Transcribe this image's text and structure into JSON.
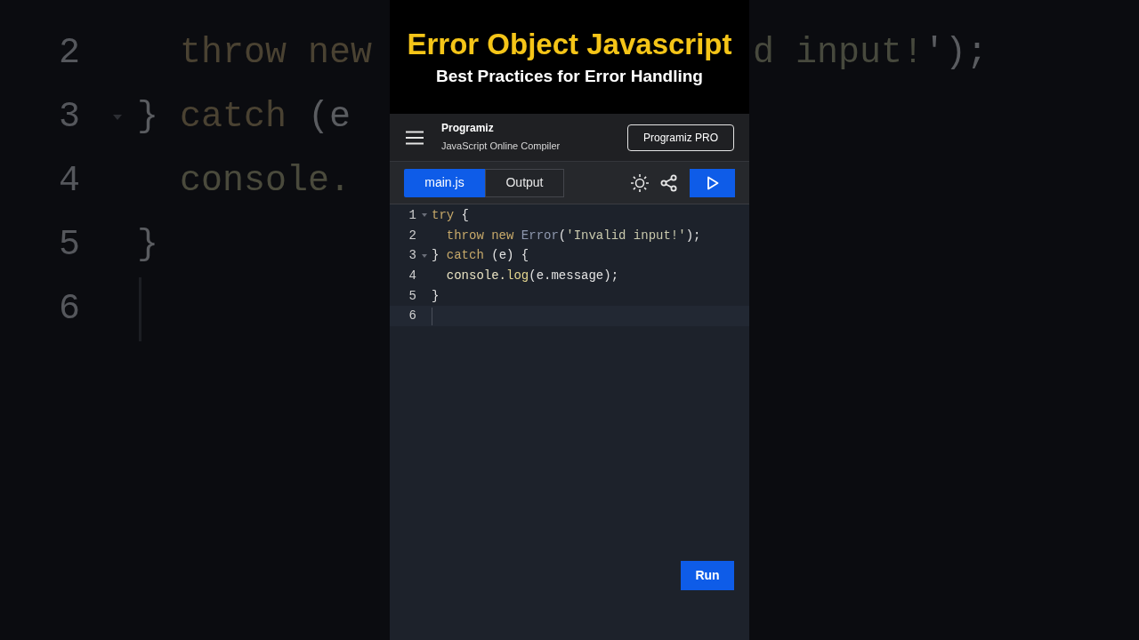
{
  "video_title": {
    "title": "Error Object Javascript",
    "subtitle": "Best Practices for Error Handling"
  },
  "header": {
    "logo": "Programiz",
    "subtitle": "JavaScript Online Compiler",
    "pro_button": "Programiz PRO"
  },
  "tabs": [
    {
      "label": "main.js",
      "selected": true
    },
    {
      "label": "Output",
      "selected": false
    }
  ],
  "editor": {
    "lines": [
      {
        "number": "1",
        "foldable": true,
        "active": false,
        "tokens": [
          {
            "text": "try",
            "kind": "keyword"
          },
          {
            "text": " {",
            "kind": "plain"
          }
        ]
      },
      {
        "number": "2",
        "foldable": false,
        "active": false,
        "tokens": [
          {
            "text": "  throw new ",
            "kind": "keyword"
          },
          {
            "text": "Error",
            "kind": "type"
          },
          {
            "text": "(",
            "kind": "plain"
          },
          {
            "text": "'Invalid input!'",
            "kind": "string"
          },
          {
            "text": ");",
            "kind": "plain"
          }
        ]
      },
      {
        "number": "3",
        "foldable": true,
        "active": false,
        "tokens": [
          {
            "text": "} ",
            "kind": "plain"
          },
          {
            "text": "catch",
            "kind": "keyword"
          },
          {
            "text": " (e) {",
            "kind": "plain"
          }
        ]
      },
      {
        "number": "4",
        "foldable": false,
        "active": false,
        "tokens": [
          {
            "text": "  console.",
            "kind": "object"
          },
          {
            "text": "log",
            "kind": "method"
          },
          {
            "text": "(e.message);",
            "kind": "plain"
          }
        ]
      },
      {
        "number": "5",
        "foldable": false,
        "active": false,
        "tokens": [
          {
            "text": "}",
            "kind": "plain"
          }
        ]
      },
      {
        "number": "6",
        "foldable": false,
        "active": true
      }
    ]
  },
  "run_button": "Run",
  "backdrop": {
    "left_lines": [
      {
        "number": "2",
        "foldable": false,
        "cursor": false,
        "tokens": [
          {
            "text": "  throw new",
            "kind": "keyword"
          }
        ]
      },
      {
        "number": "3",
        "foldable": true,
        "cursor": false,
        "tokens": [
          {
            "text": "} ",
            "kind": "plain"
          },
          {
            "text": "catch",
            "kind": "keyword"
          },
          {
            "text": " (e",
            "kind": "plain"
          }
        ]
      },
      {
        "number": "4",
        "foldable": false,
        "cursor": false,
        "tokens": [
          {
            "text": "  console.",
            "kind": "object"
          }
        ]
      },
      {
        "number": "5",
        "foldable": false,
        "cursor": false,
        "tokens": [
          {
            "text": "}",
            "kind": "plain"
          }
        ]
      },
      {
        "number": "6",
        "foldable": false,
        "cursor": true
      }
    ],
    "right_lines": [
      {
        "tokens": [
          {
            "text": "d input!",
            "kind": "string"
          },
          {
            "text": "');",
            "kind": "plain"
          }
        ]
      }
    ]
  }
}
